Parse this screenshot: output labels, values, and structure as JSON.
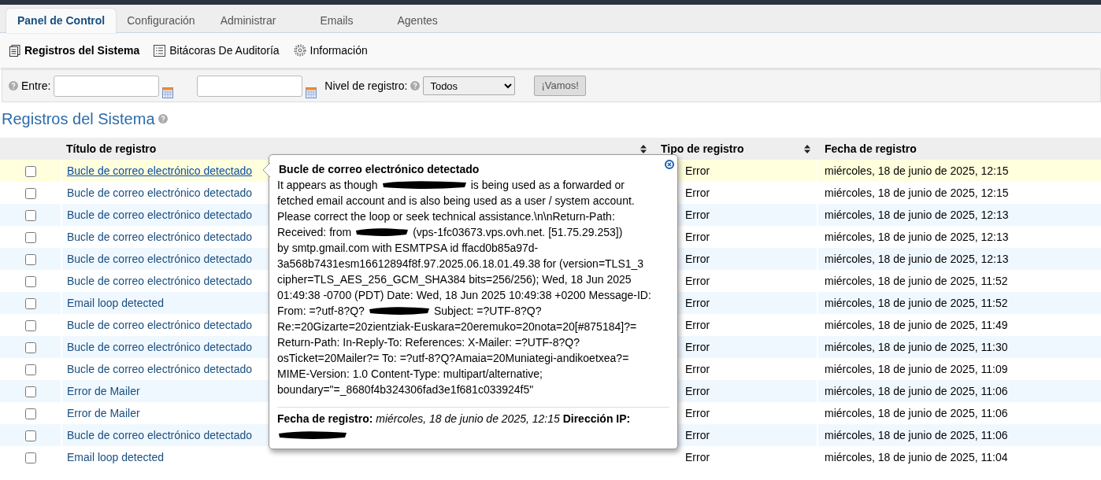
{
  "tabs": [
    {
      "label": "Panel de Control",
      "selected": true
    },
    {
      "label": "Configuración",
      "selected": false
    },
    {
      "label": "Administrar",
      "selected": false
    },
    {
      "label": "Emails",
      "selected": false
    },
    {
      "label": "Agentes",
      "selected": false
    }
  ],
  "subnav": [
    {
      "label": "Registros del Sistema",
      "kind": "logs",
      "selected": true
    },
    {
      "label": "Bitácoras De Auditoría",
      "kind": "audit",
      "selected": false
    },
    {
      "label": "Información",
      "kind": "info",
      "selected": false
    }
  ],
  "filter": {
    "between_label": "Entre:",
    "level_label": "Nivel de registro:",
    "level_value": "Todos",
    "submit": "¡Vamos!"
  },
  "heading": "Registros del Sistema",
  "table": {
    "columns": [
      "Título de registro",
      "Tipo de registro",
      "Fecha de registro"
    ],
    "rows": [
      {
        "title": "Bucle de correo electrónico detectado",
        "type": "Error",
        "date": "miércoles, 18 de junio de 2025, 12:15",
        "checked": false,
        "selected": true
      },
      {
        "title": "Bucle de correo electrónico detectado",
        "type": "Error",
        "date": "miércoles, 18 de junio de 2025, 12:15",
        "checked": false,
        "selected": false
      },
      {
        "title": "Bucle de correo electrónico detectado",
        "type": "Error",
        "date": "miércoles, 18 de junio de 2025, 12:13",
        "checked": false,
        "selected": false
      },
      {
        "title": "Bucle de correo electrónico detectado",
        "type": "Error",
        "date": "miércoles, 18 de junio de 2025, 12:13",
        "checked": false,
        "selected": false
      },
      {
        "title": "Bucle de correo electrónico detectado",
        "type": "Error",
        "date": "miércoles, 18 de junio de 2025, 12:13",
        "checked": false,
        "selected": false
      },
      {
        "title": "Bucle de correo electrónico detectado",
        "type": "Error",
        "date": "miércoles, 18 de junio de 2025, 11:52",
        "checked": false,
        "selected": false
      },
      {
        "title": "Email loop detected",
        "type": "Error",
        "date": "miércoles, 18 de junio de 2025, 11:52",
        "checked": false,
        "selected": false
      },
      {
        "title": "Bucle de correo electrónico detectado",
        "type": "Error",
        "date": "miércoles, 18 de junio de 2025, 11:49",
        "checked": false,
        "selected": false
      },
      {
        "title": "Bucle de correo electrónico detectado",
        "type": "Error",
        "date": "miércoles, 18 de junio de 2025, 11:30",
        "checked": false,
        "selected": false
      },
      {
        "title": "Bucle de correo electrónico detectado",
        "type": "Error",
        "date": "miércoles, 18 de junio de 2025, 11:09",
        "checked": false,
        "selected": false
      },
      {
        "title": "Error de Mailer",
        "type": "Error",
        "date": "miércoles, 18 de junio de 2025, 11:06",
        "checked": false,
        "selected": false
      },
      {
        "title": "Error de Mailer",
        "type": "Error",
        "date": "miércoles, 18 de junio de 2025, 11:06",
        "checked": false,
        "selected": false
      },
      {
        "title": "Bucle de correo electrónico detectado",
        "type": "Error",
        "date": "miércoles, 18 de junio de 2025, 11:06",
        "checked": false,
        "selected": false
      },
      {
        "title": "Email loop detected",
        "type": "Error",
        "date": "miércoles, 18 de junio de 2025, 11:04",
        "checked": false,
        "selected": false
      }
    ]
  },
  "popover": {
    "title": "Bucle de correo electrónico detectado",
    "message_lines": [
      [
        {
          "kind": "text",
          "text": "It appears as though"
        },
        {
          "kind": "redacted"
        },
        {
          "kind": "text",
          "text": "is being used as a forwarded or"
        }
      ],
      [
        {
          "kind": "text",
          "text": "fetched email account and is also being used as a user / system account."
        }
      ],
      [
        {
          "kind": "text",
          "text": "Please correct the loop or seek technical assistance.\\n\\nReturn-Path:"
        }
      ],
      [
        {
          "kind": "text",
          "text": "Received: from"
        },
        {
          "kind": "redacted"
        },
        {
          "kind": "text",
          "text": "(vps-1fc03673.vps.ovh.net. [51.75.29.253])"
        }
      ],
      [
        {
          "kind": "text",
          "text": "by smtp.gmail.com with ESMTPSA id ffacd0b85a97d-"
        }
      ],
      [
        {
          "kind": "text",
          "text": "3a568b7431esm16612894f8f.97.2025.06.18.01.49.38 for (version=TLS1_3"
        }
      ],
      [
        {
          "kind": "text",
          "text": "cipher=TLS_AES_256_GCM_SHA384 bits=256/256); Wed, 18 Jun 2025"
        }
      ],
      [
        {
          "kind": "text",
          "text": "01:49:38 -0700 (PDT) Date: Wed, 18 Jun 2025 10:49:38 +0200 Message-ID:"
        }
      ],
      [
        {
          "kind": "text",
          "text": "From: =?utf-8?Q?"
        },
        {
          "kind": "redacted"
        },
        {
          "kind": "text",
          "text": "Subject: =?UTF-8?Q?"
        }
      ],
      [
        {
          "kind": "text",
          "text": "Re:=20Gizarte=20zientziak-Euskara=20eremuko=20nota=20[#875184]?="
        }
      ],
      [
        {
          "kind": "text",
          "text": "Return-Path: In-Reply-To: References: X-Mailer: =?UTF-8?Q?"
        }
      ],
      [
        {
          "kind": "text",
          "text": "osTicket=20Mailer?= To: =?utf-8?Q?Amaia=20Muniategi-andikoetxea?="
        }
      ],
      [
        {
          "kind": "text",
          "text": "MIME-Version: 1.0 Content-Type: multipart/alternative;"
        }
      ],
      [
        {
          "kind": "text",
          "text": "boundary=\"=_8680f4b324306fad3e1f681c033924f5\""
        }
      ]
    ],
    "footer": "**Fecha de registro:** *miércoles, 18 de junio de 2025, 12:15* **Dirección IP:**"
  }
}
